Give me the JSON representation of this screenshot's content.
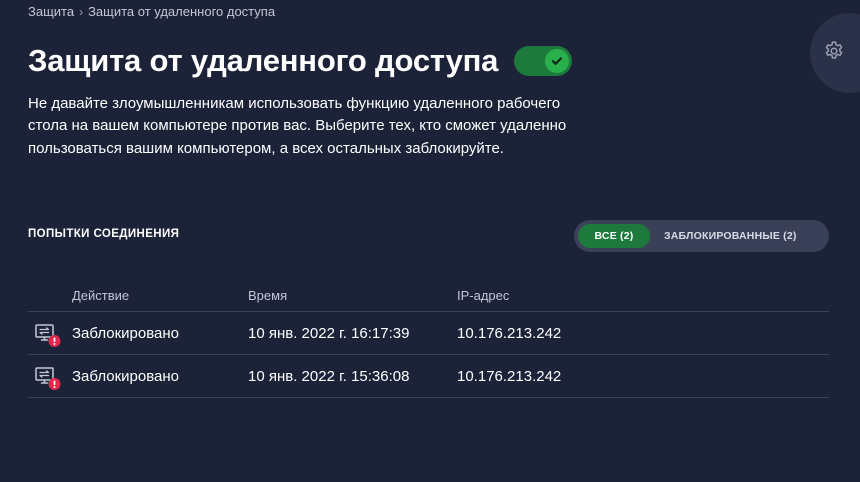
{
  "breadcrumb": {
    "parent": "Защита",
    "separator": "›",
    "current": "Защита от удаленного доступа"
  },
  "header": {
    "title": "Защита от удаленного доступа",
    "toggle_on": true
  },
  "description": "Не давайте злоумышленникам использовать функцию удаленного рабочего стола на вашем компьютере против вас. Выберите тех, кто сможет удаленно пользоваться вашим компьютером, а всех остальных заблокируйте.",
  "section": {
    "label": "ПОПЫТКИ СОЕДИНЕНИЯ"
  },
  "filters": {
    "all_label": "ВСЕ (2)",
    "blocked_label": "ЗАБЛОКИРОВАННЫЕ (2)",
    "active": "all"
  },
  "table": {
    "columns": {
      "action": "Действие",
      "time": "Время",
      "ip": "IP-адрес"
    },
    "rows": [
      {
        "icon": "remote-desktop-blocked-icon",
        "action": "Заблокировано",
        "time": "10 янв. 2022 г. 16:17:39",
        "ip": "10.176.213.242"
      },
      {
        "icon": "remote-desktop-blocked-icon",
        "action": "Заблокировано",
        "time": "10 янв. 2022 г. 15:36:08",
        "ip": "10.176.213.242"
      }
    ]
  },
  "icons": {
    "settings": "gear-icon",
    "toggle_check": "check-icon"
  },
  "colors": {
    "background": "#1c2238",
    "accent_green": "#1d7a3c",
    "knob_green": "#28b14a",
    "alert_red": "#e4264c",
    "divider": "#394057"
  }
}
